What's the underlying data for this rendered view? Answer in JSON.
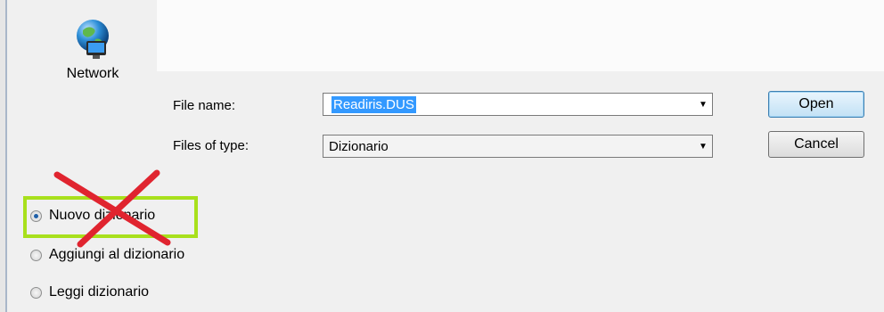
{
  "places": {
    "network_label": "Network"
  },
  "fields": {
    "file_name_label": "File name:",
    "file_name_value": "Readiris.DUS",
    "files_of_type_label": "Files of type:",
    "files_of_type_value": "Dizionario"
  },
  "buttons": {
    "open": "Open",
    "cancel": "Cancel"
  },
  "options": {
    "nuovo": "Nuovo dizionario",
    "aggiungi": "Aggiungi al dizionario",
    "leggi": "Leggi dizionario",
    "selected": "Nuovo dizionario"
  },
  "colors": {
    "highlight": "#a8e01c",
    "cross": "#e0242f",
    "selection": "#3399ff"
  }
}
